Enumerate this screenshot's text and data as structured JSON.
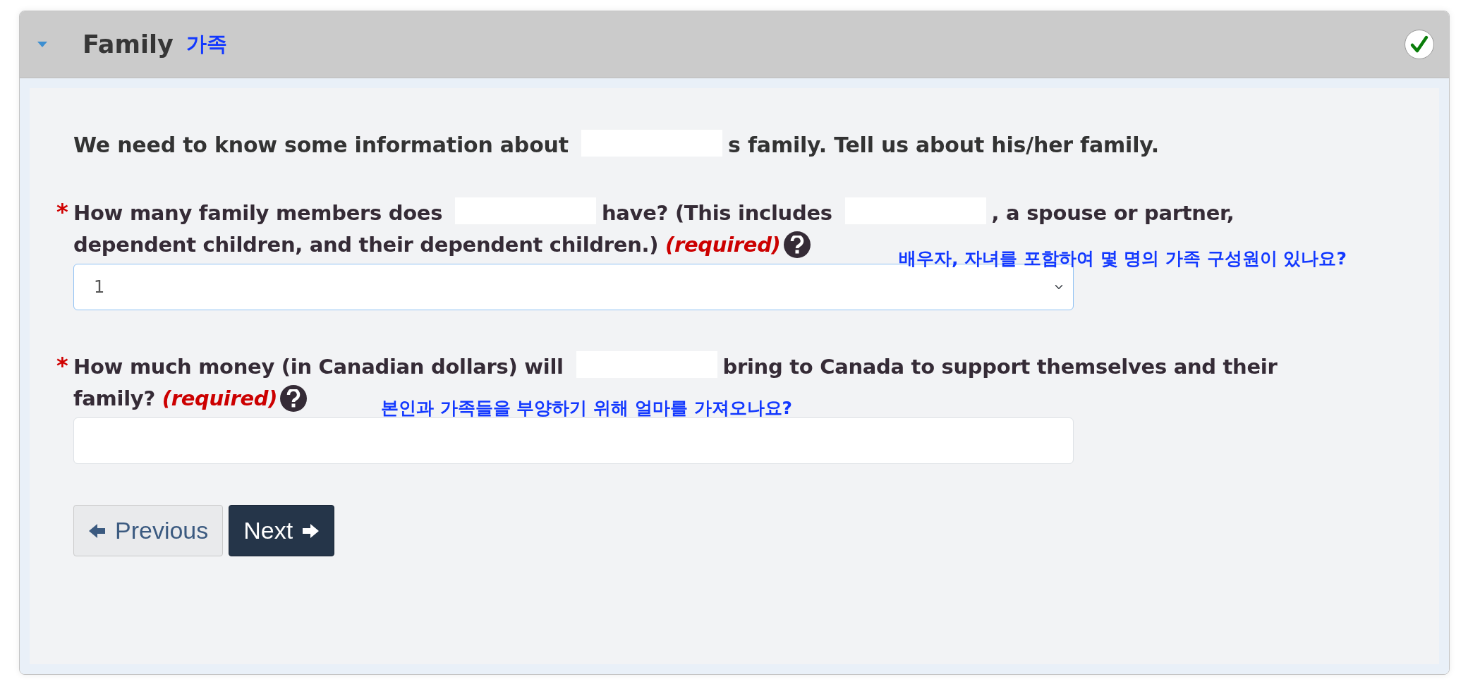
{
  "panel": {
    "title": "Family",
    "title_translation": "가족",
    "expanded": true,
    "complete": true
  },
  "intro": [
    {
      "kind": "text",
      "text": "We need to know some information about"
    },
    {
      "kind": "redacted"
    },
    {
      "kind": "text",
      "text": "s family. Tell us about his/her family."
    }
  ],
  "questions": [
    {
      "kind": "select",
      "required": true,
      "label": [
        {
          "kind": "text",
          "text": "How many family members does"
        },
        {
          "kind": "redacted"
        },
        {
          "kind": "text",
          "text": "have? (This includes"
        },
        {
          "kind": "redacted"
        },
        {
          "kind": "text",
          "text": ", a spouse or partner, dependent children, and their dependent children.)"
        }
      ],
      "required_text": "(required)",
      "translation": "배우자, 자녀를 포함하여 몇 명의 가족 구성원이 있나요?",
      "value": "1"
    },
    {
      "kind": "input",
      "required": true,
      "label": [
        {
          "kind": "text",
          "text": "How much money (in Canadian dollars) will"
        },
        {
          "kind": "redacted"
        },
        {
          "kind": "text",
          "text": "bring to Canada to support themselves and their family?"
        }
      ],
      "required_text": "(required)",
      "translation": "본인과 가족들을 부양하기 위해 얼마를 가져오나요?"
    }
  ],
  "required_mark": "*",
  "buttons": [
    {
      "kind": "previous",
      "label": "Previous"
    },
    {
      "kind": "next",
      "label": "Next"
    }
  ]
}
